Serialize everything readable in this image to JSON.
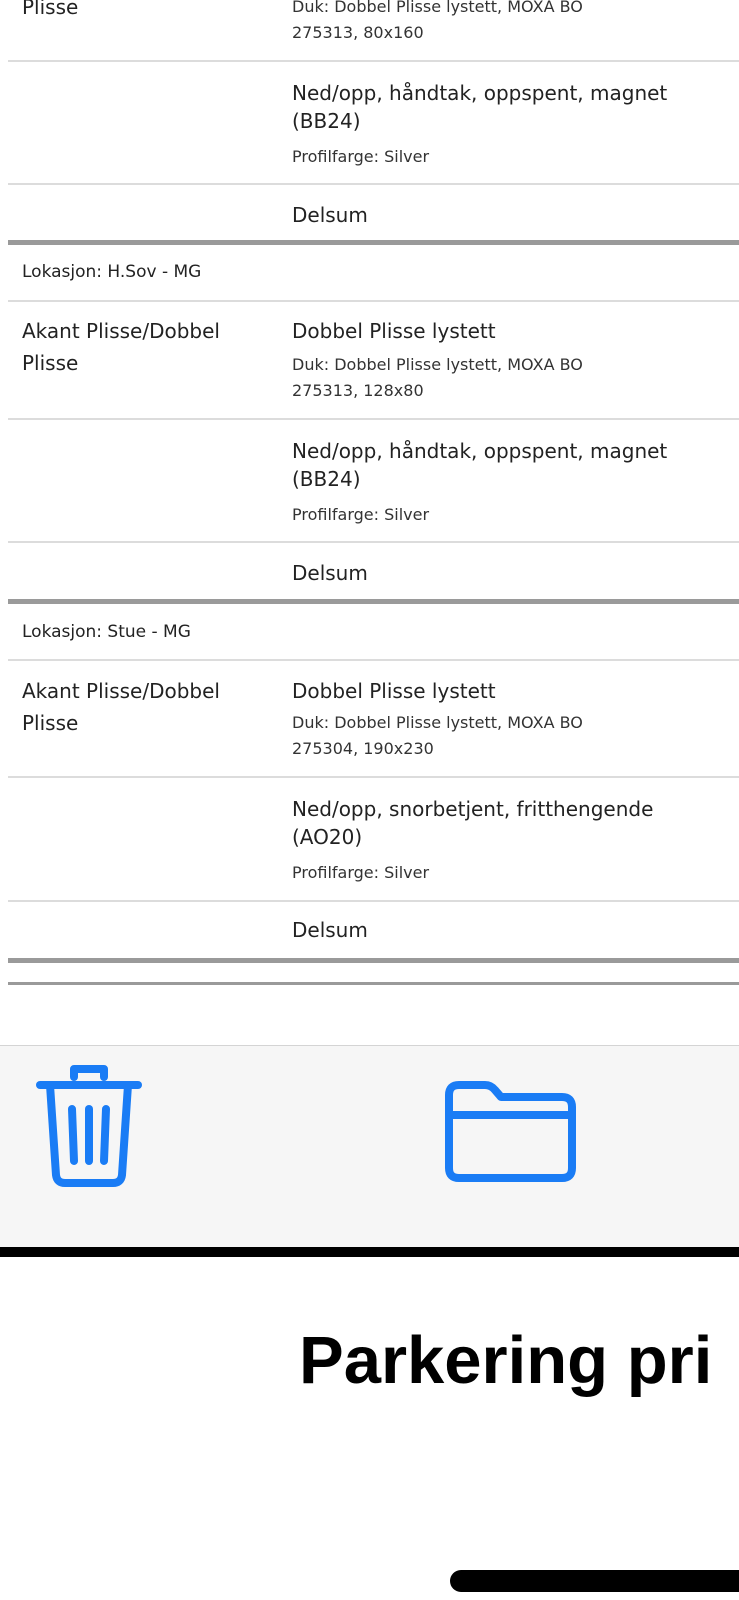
{
  "document": {
    "top_row": {
      "product_cont": "Plisse",
      "fabric_line1": "Duk: Dobbel Plisse lystett, MOXA BO",
      "fabric_line2": "275313, 80x160"
    },
    "top_operation": {
      "line1": "Ned/opp, håndtak, oppspent, magnet",
      "line2": "(BB24)",
      "color": "Profilfarge: Silver"
    },
    "top_subtotal": "Delsum",
    "sections": [
      {
        "location": "Lokasjon: H.Sov - MG",
        "product_line1": "Akant Plisse/Dobbel",
        "product_line2": "Plisse",
        "item_title": "Dobbel Plisse lystett",
        "fabric_line1": "Duk: Dobbel Plisse lystett, MOXA BO",
        "fabric_line2": "275313, 128x80",
        "operation_line1": "Ned/opp, håndtak, oppspent, magnet",
        "operation_line2": "(BB24)",
        "color": "Profilfarge: Silver",
        "subtotal": "Delsum"
      },
      {
        "location": "Lokasjon: Stue - MG",
        "product_line1": "Akant Plisse/Dobbel",
        "product_line2": "Plisse",
        "item_title": "Dobbel Plisse lystett",
        "fabric_line1": "Duk: Dobbel Plisse lystett, MOXA BO",
        "fabric_line2": "275304, 190x230",
        "operation_line1": "Ned/opp, snorbetjent, fritthengende",
        "operation_line2": "(AO20)",
        "color": "Profilfarge: Silver",
        "subtotal": "Delsum"
      }
    ]
  },
  "toolbar": {
    "accent_color": "#1a7cf5",
    "buttons": [
      {
        "icon": "trash-icon"
      },
      {
        "icon": "folder-icon"
      }
    ]
  },
  "page_title": "Parkering pri"
}
